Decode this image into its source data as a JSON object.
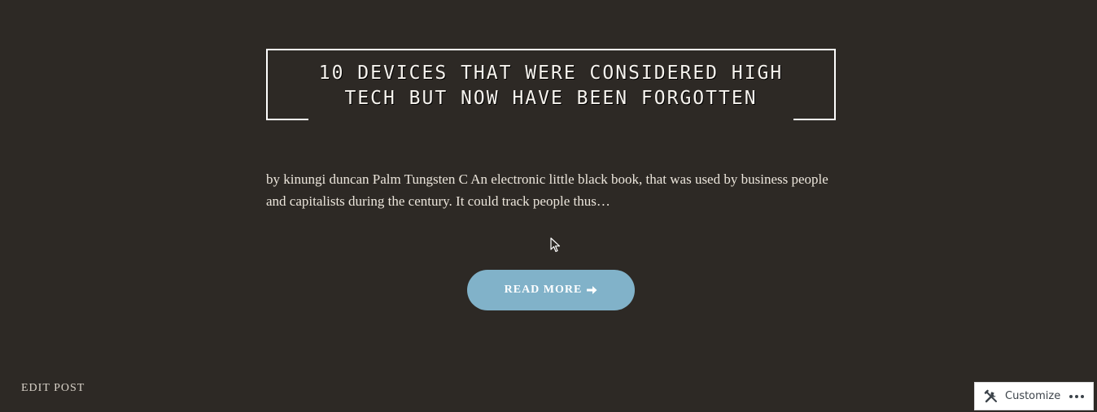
{
  "post": {
    "title": "10 DEVICES THAT WERE CONSIDERED HIGH TECH BUT NOW HAVE BEEN FORGOTTEN",
    "excerpt": "by kinungi duncan Palm Tungsten C An electronic little black book, that was used by business people and capitalists during the century. It could track people thus…",
    "read_more_label": "READ MORE",
    "read_more_icon": "arrow-right-icon"
  },
  "footer": {
    "edit_post_label": "EDIT POST"
  },
  "customizer_bar": {
    "customize_label": "Customize",
    "customize_icon": "tools-icon",
    "more_icon": "ellipsis-icon"
  },
  "colors": {
    "background": "#2d2925",
    "title_frame": "#ffffff",
    "text": "#ece6dc",
    "button": "#81b2c9",
    "button_text": "#ffffff",
    "admin_bar_bg": "#ffffff",
    "admin_bar_text": "#3c434a"
  }
}
